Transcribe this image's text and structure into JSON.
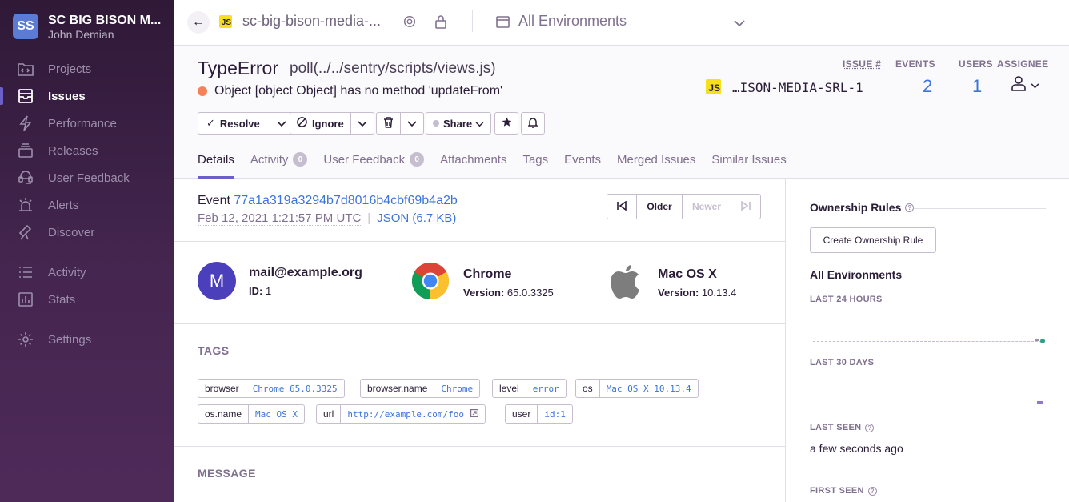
{
  "sidebar": {
    "org_initials": "SS",
    "org_name": "SC BIG BISON M...",
    "user_name": "John Demian",
    "items": [
      {
        "label": "Projects",
        "icon": "projects-icon"
      },
      {
        "label": "Issues",
        "icon": "issues-icon",
        "active": true
      },
      {
        "label": "Performance",
        "icon": "lightning-icon"
      },
      {
        "label": "Releases",
        "icon": "releases-icon"
      },
      {
        "label": "User Feedback",
        "icon": "feedback-icon"
      },
      {
        "label": "Alerts",
        "icon": "siren-icon"
      },
      {
        "label": "Discover",
        "icon": "telescope-icon"
      },
      {
        "label": "Activity",
        "icon": "list-icon"
      },
      {
        "label": "Stats",
        "icon": "stats-icon"
      },
      {
        "label": "Settings",
        "icon": "gear-icon"
      }
    ]
  },
  "topbar": {
    "platform_badge": "JS",
    "project_name": "sc-big-bison-media-...",
    "environment": "All Environments"
  },
  "issue": {
    "type": "TypeError",
    "location": "poll(../../sentry/scripts/views.js)",
    "message": "Object [object Object] has no method 'updateFrom'",
    "level_color": "#f58159",
    "actions": {
      "resolve": "Resolve",
      "ignore": "Ignore",
      "share": "Share"
    },
    "stats": {
      "issue_label": "ISSUE #",
      "events_label": "EVENTS",
      "users_label": "USERS",
      "assignee_label": "ASSIGNEE",
      "short_id": "…ISON-MEDIA-SRL-1",
      "events": "2",
      "users": "1"
    },
    "tabs": [
      {
        "label": "Details",
        "active": true
      },
      {
        "label": "Activity",
        "badge": "0"
      },
      {
        "label": "User Feedback",
        "badge": "0"
      },
      {
        "label": "Attachments"
      },
      {
        "label": "Tags"
      },
      {
        "label": "Events"
      },
      {
        "label": "Merged Issues"
      },
      {
        "label": "Similar Issues"
      }
    ]
  },
  "event": {
    "label": "Event",
    "id": "77a1a319a3294b7d8016b4cbf69b4a2b",
    "date": "Feb 12, 2021 1:21:57 PM UTC",
    "json_link": "JSON (6.7 KB)",
    "pager": {
      "older": "Older",
      "newer": "Newer"
    }
  },
  "contexts": {
    "user": {
      "initial": "M",
      "title": "mail@example.org",
      "sub_label": "ID:",
      "sub_value": "1"
    },
    "browser": {
      "title": "Chrome",
      "sub_label": "Version:",
      "sub_value": "65.0.3325"
    },
    "os": {
      "title": "Mac OS X",
      "sub_label": "Version:",
      "sub_value": "10.13.4"
    }
  },
  "tags_section": {
    "title": "TAGS",
    "tags": [
      {
        "key": "browser",
        "value": "Chrome 65.0.3325"
      },
      {
        "key": "browser.name",
        "value": "Chrome"
      },
      {
        "key": "level",
        "value": "error"
      },
      {
        "key": "os",
        "value": "Mac OS X 10.13.4"
      },
      {
        "key": "os.name",
        "value": "Mac OS X"
      },
      {
        "key": "url",
        "value": "http://example.com/foo"
      },
      {
        "key": "user",
        "value": "id:1"
      }
    ]
  },
  "message_section": {
    "title": "MESSAGE"
  },
  "right_panel": {
    "ownership_title": "Ownership Rules",
    "create_rule": "Create Ownership Rule",
    "environments_title": "All Environments",
    "last_24h": "LAST 24 HOURS",
    "last_30d": "LAST 30 DAYS",
    "last_seen_label": "LAST SEEN",
    "last_seen_value": "a few seconds ago",
    "first_seen_label": "FIRST SEEN"
  }
}
